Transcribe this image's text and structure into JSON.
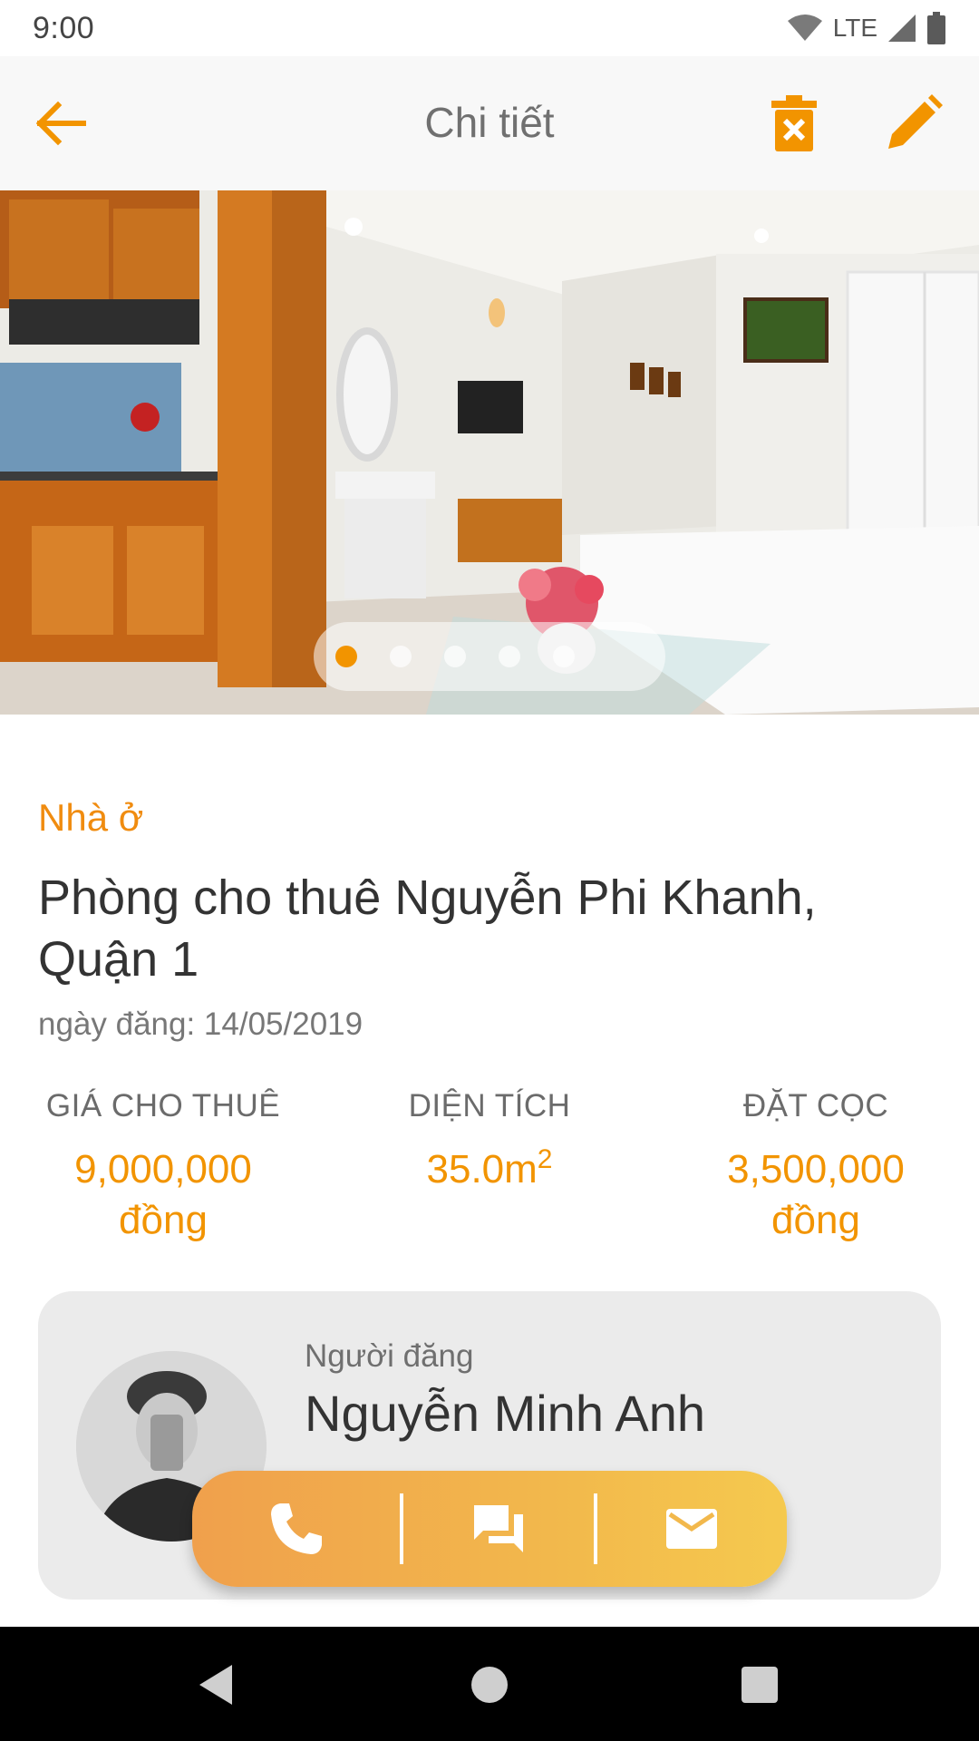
{
  "status_bar": {
    "time": "9:00",
    "network": "LTE",
    "icons": [
      "wifi-icon",
      "signal-icon",
      "battery-icon"
    ]
  },
  "app_bar": {
    "title": "Chi tiết",
    "back_icon": "arrow-left-icon",
    "delete_icon": "delete-icon",
    "edit_icon": "pencil-icon"
  },
  "gallery": {
    "image": "room-interior-photo",
    "dots": 5,
    "active_dot": 0
  },
  "listing": {
    "category": "Nhà ở",
    "title": "Phòng cho thuê Nguyễn Phi Khanh, Quận 1",
    "posted_date": "ngày đăng: 14/05/2019"
  },
  "stats": {
    "price_label": "GIÁ CHO THUÊ",
    "price_value": "9,000,000 đồng",
    "area_label": "DIỆN TÍCH",
    "area_value": "35.0m",
    "area_unit_sup": "2",
    "deposit_label": "ĐẶT CỌC",
    "deposit_value": "3,500,000 đồng"
  },
  "poster": {
    "label": "Người đăng",
    "name": "Nguyễn Minh Anh"
  },
  "actions": {
    "icons": [
      "phone-icon",
      "chat-icon",
      "mail-icon"
    ]
  },
  "nav": {
    "icons": [
      "back-triangle-icon",
      "home-circle-icon",
      "recents-square-icon"
    ]
  },
  "colors": {
    "accent": "#f29400",
    "card": "#ebebeb",
    "appbar": "#f8f8f8"
  }
}
